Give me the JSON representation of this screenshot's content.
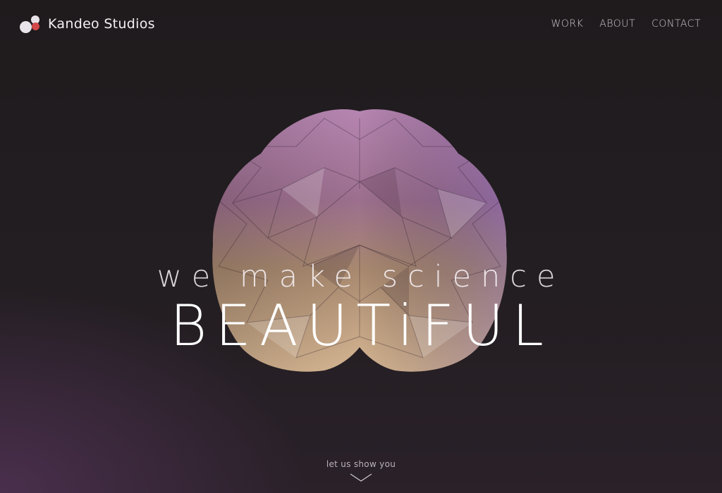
{
  "brand": {
    "name": "Kandeo Studios",
    "logo_icon": "molecule-logo-icon"
  },
  "nav": {
    "items": [
      {
        "label": "WORK"
      },
      {
        "label": "ABOUT"
      },
      {
        "label": "CONTACT"
      }
    ]
  },
  "hero": {
    "tagline": "we make science",
    "headline": "BEAUTiFUL",
    "illustration": "low-poly-brain-illustration"
  },
  "scroll_cue": {
    "label": "let us show you",
    "icon": "chevron-down-icon"
  },
  "colors": {
    "background": "#201c1f",
    "accent_glow": "#4a2f4d",
    "logo_red": "#d5484a",
    "text": "#e9e4ea"
  }
}
